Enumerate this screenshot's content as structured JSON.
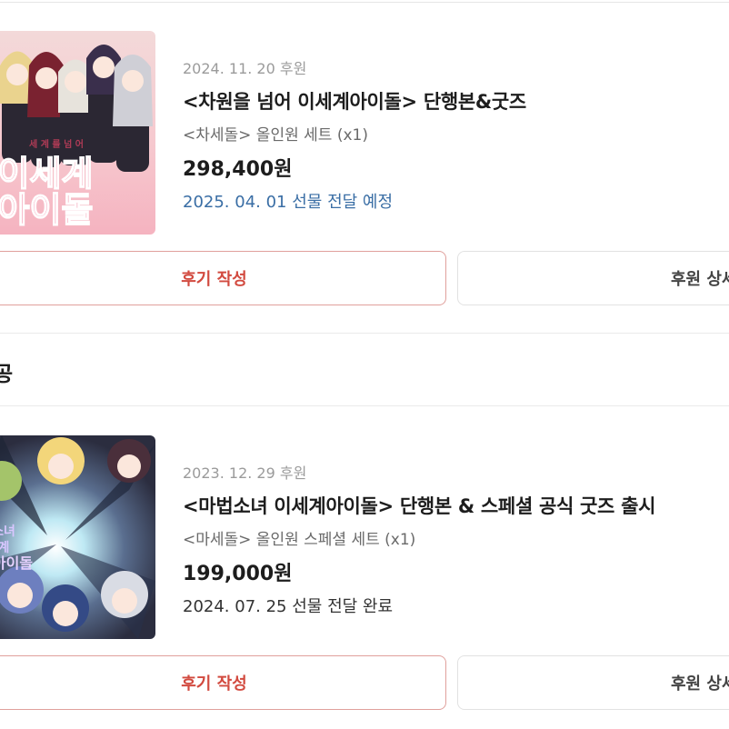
{
  "pledges": [
    {
      "date": "2024. 11. 20 후원",
      "title": "<차원을 넘어 이세계아이돌> 단행본&굿즈",
      "option": "<차세돌> 올인원 세트 (x1)",
      "price": "298,400원",
      "delivery": "2025. 04. 01 선물 전달 예정",
      "cover_text_top": "세 계 를 넘 어",
      "cover_text_main_1": "이세계",
      "cover_text_main_2": "아이돌",
      "review_label": "후기 작성",
      "detail_label": "후원 상세"
    },
    {
      "date": "2023. 12. 29 후원",
      "title": "<마법소녀 이세계아이돌> 단행본 & 스페셜 공식 굿즈 출시",
      "option": "<마세돌> 올인원 스페셜 세트 (x1)",
      "price": "199,000원",
      "delivery": "2024. 07. 25 선물 전달 완료",
      "cover_text_1": "소녀",
      "cover_text_2": "계",
      "cover_text_3": "아이돌",
      "review_label": "후기 작성",
      "detail_label": "후원 상세"
    }
  ],
  "section": {
    "title": "공"
  },
  "colors": {
    "review_text": "#d24a3f",
    "review_border": "#e0a09c",
    "delivery_scheduled": "#3a6ea5",
    "delivery_done": "#333333"
  }
}
